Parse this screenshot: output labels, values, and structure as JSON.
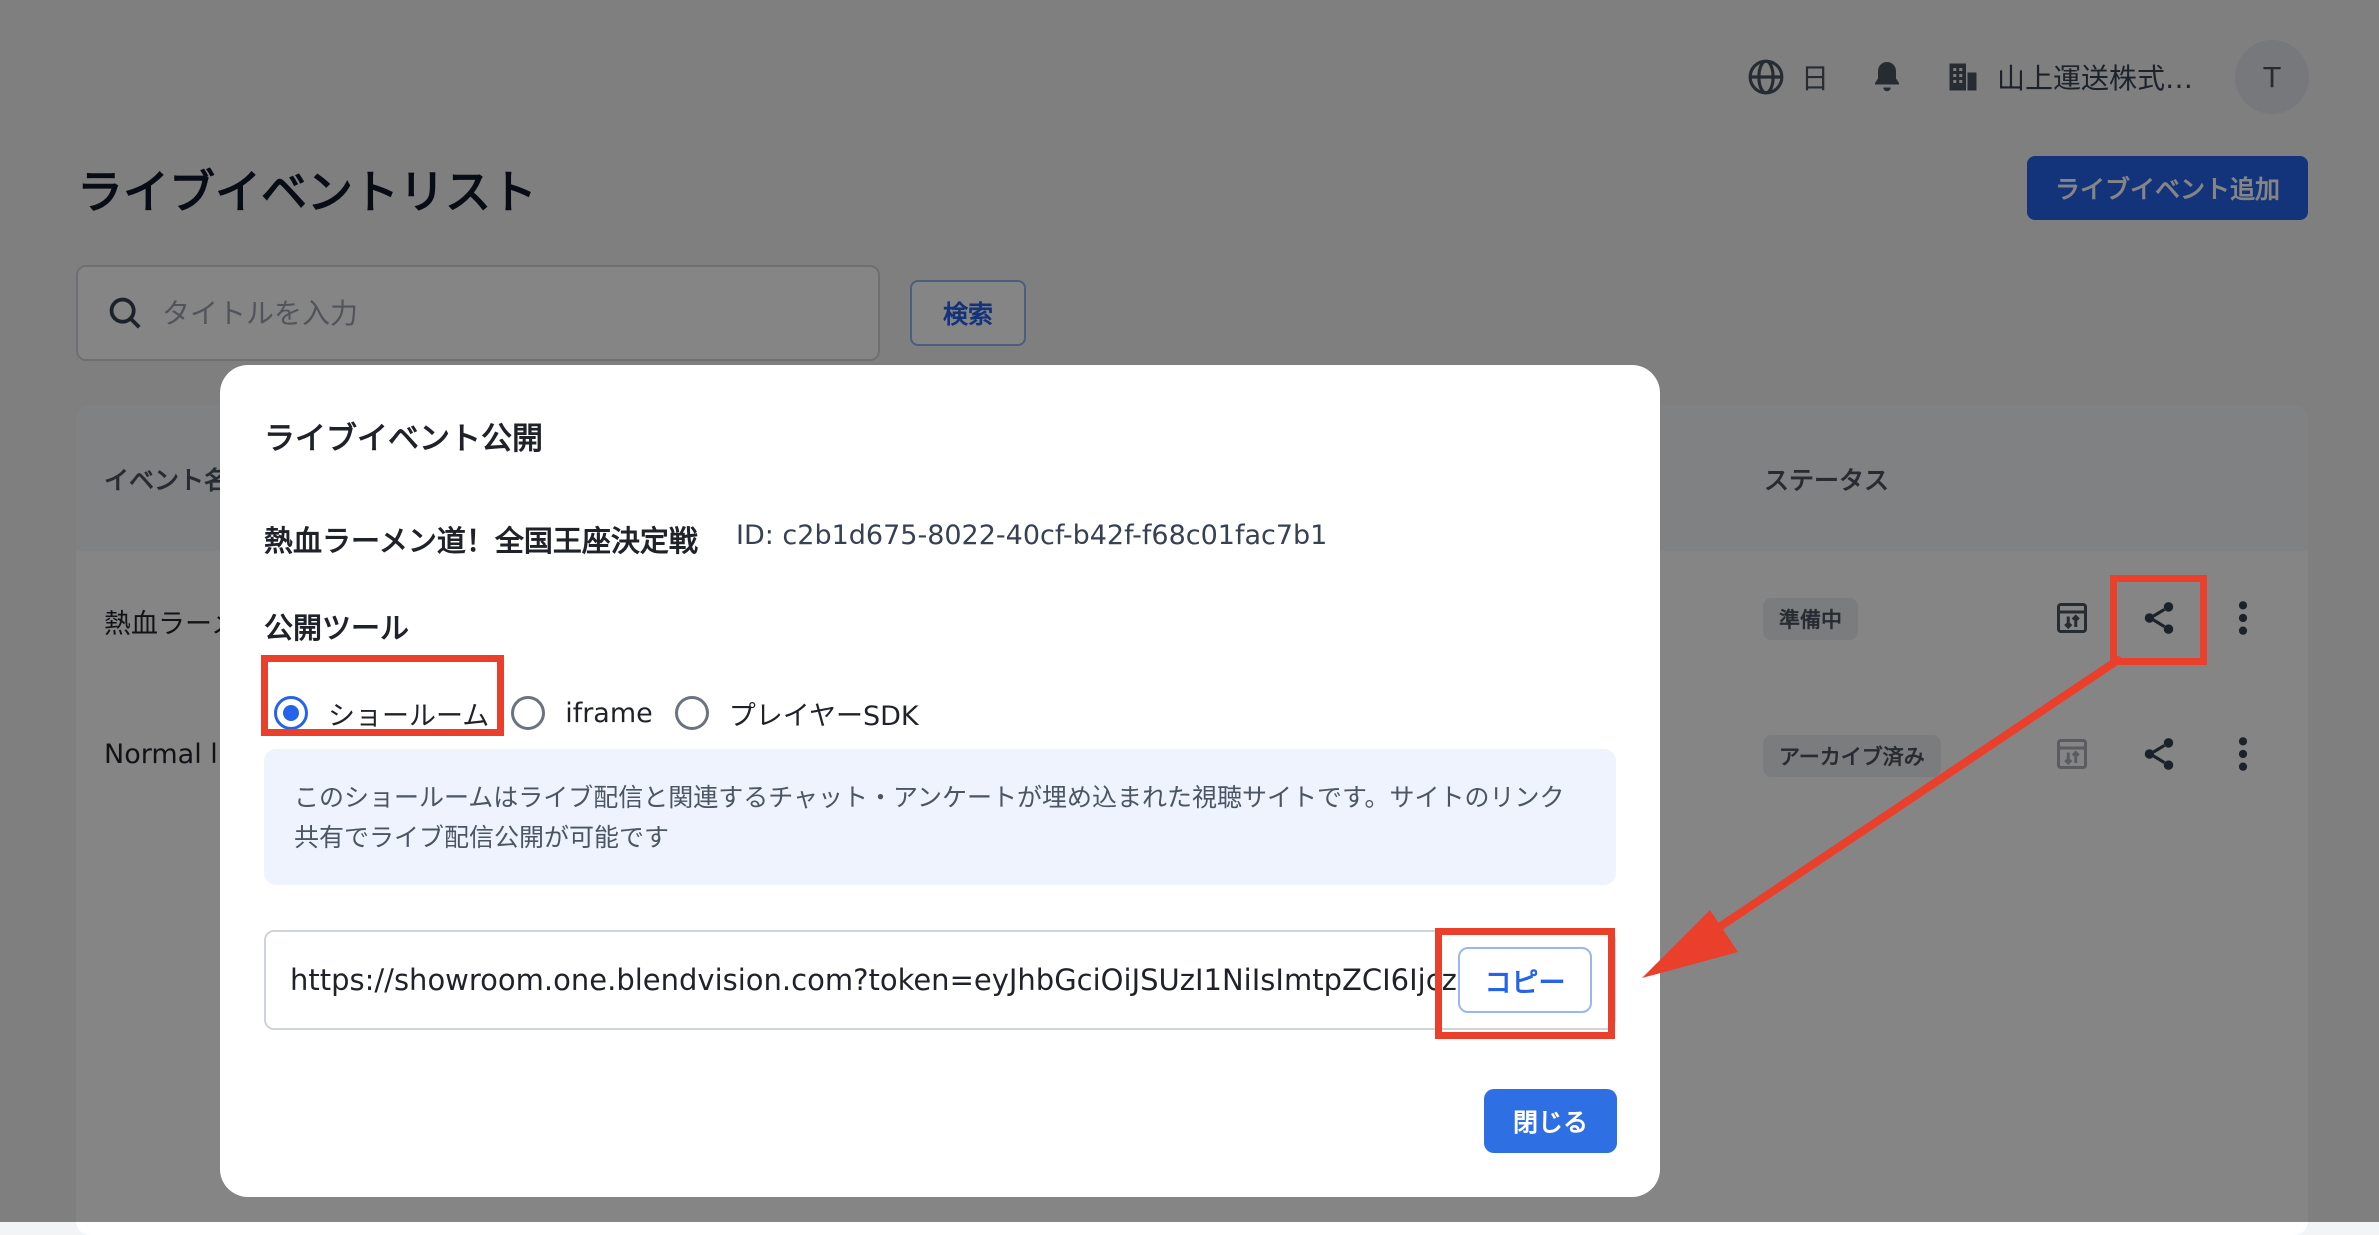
{
  "header": {
    "language_label": "日",
    "organization_name": "山上運送株式…",
    "avatar_initial": "T"
  },
  "page": {
    "title": "ライブイベントリスト",
    "add_button_label": "ライブイベント追加",
    "search": {
      "placeholder": "タイトルを入力",
      "button_label": "検索"
    }
  },
  "table": {
    "columns": [
      "イベント名",
      "ステータス"
    ],
    "rows": [
      {
        "name": "熱血ラーメ",
        "status": "準備中"
      },
      {
        "name": "Normal liv",
        "status": "アーカイブ済み"
      }
    ]
  },
  "modal": {
    "title": "ライブイベント公開",
    "event_name": "熱血ラーメン道！全国王座決定戦",
    "event_id": "ID: c2b1d675-8022-40cf-b42f-f68c01fac7b1",
    "tools_label": "公開ツール",
    "radio_options": [
      {
        "label": "ショールーム",
        "selected": true
      },
      {
        "label": "iframe",
        "selected": false
      },
      {
        "label": "プレイヤーSDK",
        "selected": false
      }
    ],
    "description_line1": "このショールームはライブ配信と関連するチャット・アンケートが埋め込まれた視聴サイトです。サイトのリンク",
    "description_line2": "共有でライブ配信公開が可能です",
    "share_url": "https://showroom.one.blendvision.com?token=eyJhbGciOiJSUzI1NiIsImtpZCI6Ijcz",
    "copy_button_label": "コピー",
    "close_button_label": "閉じる"
  },
  "colors": {
    "primary": "#2563eb",
    "annotation_red": "#ea3f2b",
    "overlay": "rgba(0,0,0,0.48)"
  },
  "icons": [
    "globe-icon",
    "bell-icon",
    "building-icon",
    "search-icon",
    "archive-box-icon",
    "share-icon",
    "more-vertical-icon"
  ]
}
